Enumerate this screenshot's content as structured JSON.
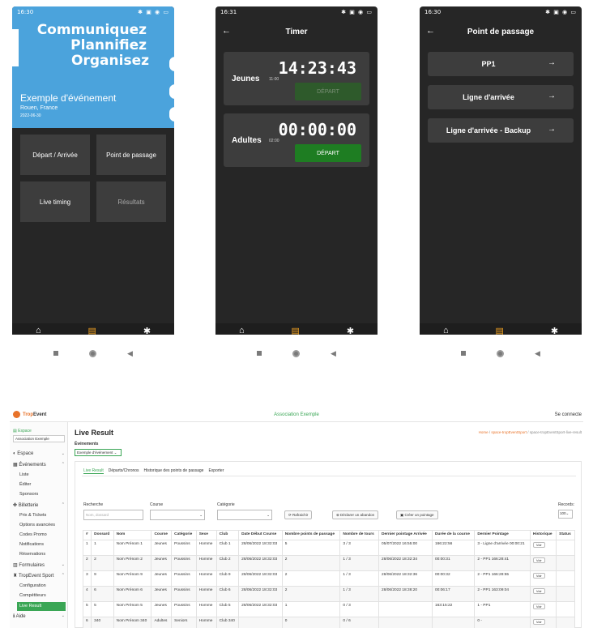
{
  "phone1": {
    "status_time": "16:30",
    "slogan": [
      "Communiquez",
      "Plannifiez",
      "Organisez"
    ],
    "event_title": "Exemple d'événement",
    "event_city": "Rouen, France",
    "event_date": "2022-06-30",
    "tiles": [
      "Départ / Arrivée",
      "Point de passage",
      "Live timing",
      "Résultats"
    ]
  },
  "phone2": {
    "status_time": "16:31",
    "title": "Timer",
    "timers": [
      {
        "label": "Jeunes",
        "small": "11:00",
        "time": "14:23:43",
        "button": "DÉPART"
      },
      {
        "label": "Adultes",
        "small": "02:00",
        "time": "00:00:00",
        "button": "DÉPART"
      }
    ]
  },
  "phone3": {
    "status_time": "16:30",
    "title": "Point de passage",
    "items": [
      "PP1",
      "Ligne d'arrivée",
      "Ligne d'arrivée - Backup"
    ]
  },
  "desktop": {
    "brand_a": "Trop",
    "brand_b": "Event",
    "center_title": "Association Exemple",
    "connect": "Se connecte",
    "sidebar": {
      "espace_label": "Espace",
      "espace_select": "Association Exemple",
      "espace": "Espace",
      "evenements": "Événements",
      "ev_sub": [
        "Liste",
        "Éditer",
        "Sponsors"
      ],
      "billetterie": "Billetterie",
      "bill_sub": [
        "Prix & Tickets",
        "Options avancées",
        "Codes Promo",
        "Notifications",
        "Réservations"
      ],
      "formulaires": "Formulaires",
      "tropevent_sport": "TropEvent Sport",
      "sport_sub": [
        "Configuration",
        "Compétiteurs"
      ],
      "active": "Live Result",
      "aide": "Aide"
    },
    "main_title": "Live Result",
    "breadcrumb_home": "Home",
    "breadcrumb_mid": "space-tropEventSport",
    "breadcrumb_last": "space-tropEventSport-live-result",
    "events_label": "Événements",
    "events_select": "Exemple d'événement",
    "tabs": [
      "Live Result",
      "Départs/Chronos",
      "Historique des points de passage",
      "Exporter"
    ],
    "filters": {
      "recherche": "Recherche",
      "recherche_ph": "Nom, dossard",
      "course": "Course",
      "categorie": "Catégorie",
      "rafraichir": "Rafraichir",
      "abandon": "Déclarer un abandon",
      "pointage": "Créer un pointage",
      "records": "Records:",
      "records_value": "100"
    },
    "table": {
      "headers": [
        "#",
        "Dossard",
        "Nom",
        "Course",
        "Catégorie",
        "Sexe",
        "Club",
        "Date Début Course",
        "Nombre points de passage",
        "Nombre de tours",
        "Dernier pointage Arrivée",
        "Durée de la course",
        "Dernier Pointage",
        "Historique",
        "Status"
      ],
      "voir": "Voir",
      "rows": [
        [
          "1",
          "1",
          "Nom Prénom 1",
          "Jeunes",
          "Poussins",
          "Homme",
          "Club 1",
          "28/06/2022 18:32:03",
          "5",
          "3 / 3",
          "05/07/2022 16:55:00",
          "166:22:56",
          "3 - Ligne d'arrivée 00:00:21"
        ],
        [
          "2",
          "2",
          "Nom Prénom 2",
          "Jeunes",
          "Poussins",
          "Homme",
          "Club 2",
          "28/06/2022 18:32:03",
          "2",
          "1 / 3",
          "28/06/2022 18:32:34",
          "00:00:31",
          "2 - PP1 166:28:41"
        ],
        [
          "3",
          "9",
          "Nom Prénom 9",
          "Jeunes",
          "Poussins",
          "Homme",
          "Club 9",
          "28/06/2022 18:32:03",
          "2",
          "1 / 3",
          "28/06/2022 18:32:36",
          "00:00:32",
          "2 - PP1 166:28:55"
        ],
        [
          "4",
          "6",
          "Nom Prénom 6",
          "Jeunes",
          "Poussins",
          "Homme",
          "Club 6",
          "28/06/2022 18:32:03",
          "2",
          "1 / 3",
          "28/06/2022 18:38:20",
          "00:06:17",
          "2 - PP1 163:09:04"
        ],
        [
          "5",
          "5",
          "Nom Prénom 5",
          "Jeunes",
          "Poussins",
          "Homme",
          "Club 5",
          "28/06/2022 18:32:03",
          "1",
          "0 / 3",
          "",
          "163:15:22",
          "1 - PP1"
        ],
        [
          "6",
          "340",
          "Nom Prénom 340",
          "Adultes",
          "Seniors",
          "Homme",
          "Club 340",
          "",
          "0",
          "0 / 6",
          "",
          "",
          "0 -"
        ]
      ]
    }
  }
}
